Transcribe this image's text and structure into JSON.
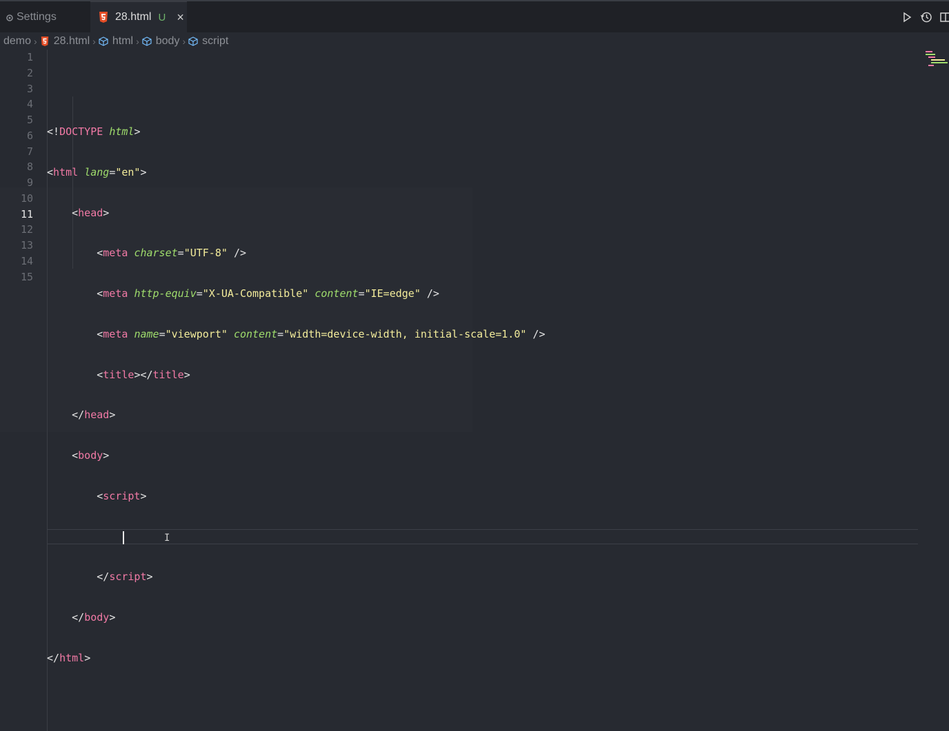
{
  "tabs": [
    {
      "label": "Settings",
      "icon": "gear-icon"
    },
    {
      "label": "28.html",
      "icon": "html5-icon",
      "badge": "U",
      "close": "×"
    }
  ],
  "breadcrumb": {
    "items": [
      "demo",
      "28.html",
      "html",
      "body",
      "script"
    ],
    "sep": "›"
  },
  "editor": {
    "line_numbers": [
      "1",
      "2",
      "3",
      "4",
      "5",
      "6",
      "7",
      "8",
      "9",
      "10",
      "11",
      "12",
      "13",
      "14",
      "15"
    ],
    "current_line": 11
  },
  "colors": {
    "background": "#272a31",
    "tag": "#f27aa6",
    "attribute": "#9fdc6c",
    "string": "#f3ec9b",
    "html5_orange": "#e44d26"
  }
}
